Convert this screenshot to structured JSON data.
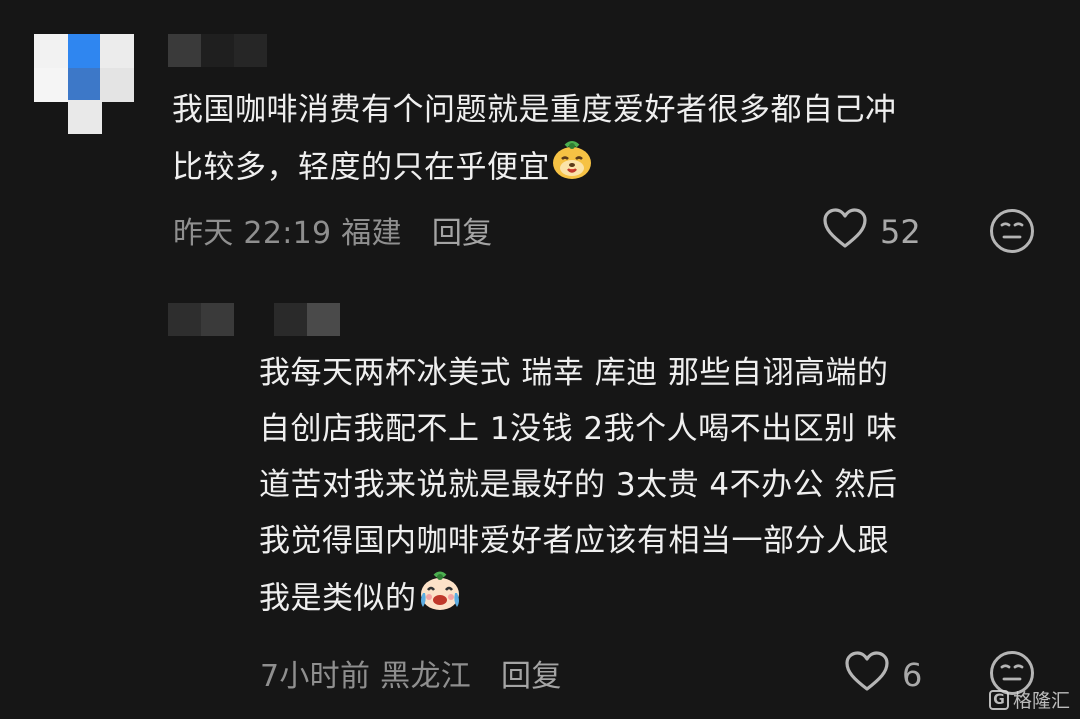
{
  "comments": [
    {
      "text": "我国咖啡消费有个问题就是重度爱好者很多都自己冲比较多，轻度的只在乎便宜",
      "line1": "我国咖啡消费有个问题就是重度爱好者很多都自己冲",
      "line2": "比较多，轻度的只在乎便宜",
      "time": "昨天 22:19",
      "location": "福建",
      "reply_label": "回复",
      "likes": "52",
      "emoji": "smiling-dog-emoji"
    },
    {
      "text": "我每天两杯冰美式 瑞幸 库迪 那些自诩高端的自创店我配不上 1没钱 2我个人喝不出区别 味道苦对我来说就是最好的 3太贵 4不办公 然后我觉得国内咖啡爱好者应该有相当一部分人跟我是类似的",
      "lines": [
        "我每天两杯冰美式   瑞幸 库迪  那些自诩高端的",
        "自创店我配不上   1没钱  2我个人喝不出区别 味",
        "道苦对我来说就是最好的 3太贵 4不办公  然后",
        "我觉得国内咖啡爱好者应该有相当一部分人跟",
        "我是类似的"
      ],
      "time": "7小时前",
      "location": "黑龙江",
      "reply_label": "回复",
      "likes": "6",
      "emoji": "crying-laughing-emoji"
    }
  ],
  "icons": {
    "like": "heart-outline-icon",
    "react": "neutral-face-icon"
  },
  "watermark": {
    "text": "格隆汇",
    "logo": "G"
  },
  "colors": {
    "background": "#161616",
    "text": "#efefef",
    "meta": "#8f8f8f"
  }
}
